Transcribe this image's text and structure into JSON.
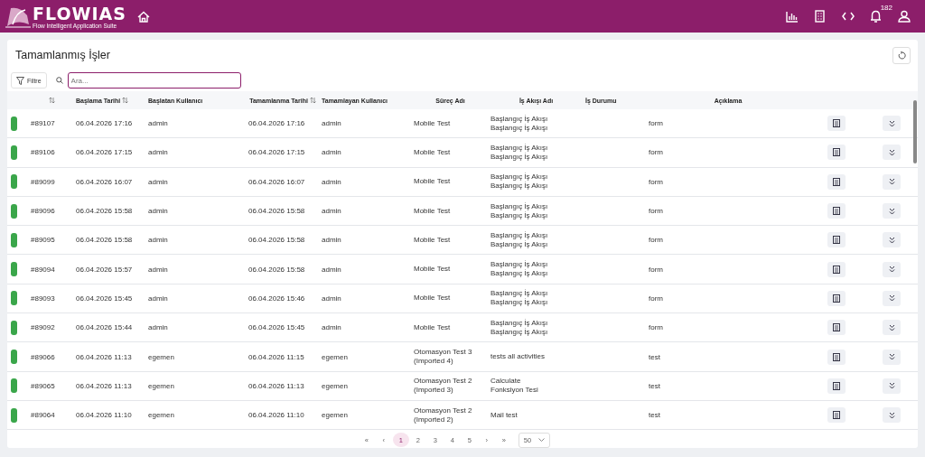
{
  "header": {
    "logo_text": "FLOWIAS",
    "logo_subtitle": "Flow Intelligent Application Suite",
    "notification_count": "182"
  },
  "page": {
    "title": "Tamamlanmış İşler",
    "filter_button": "Filtre",
    "search": {
      "placeholder": "Ara..."
    }
  },
  "table": {
    "columns": [
      "",
      "Başlama Tarihi",
      "Başlatan Kullanıcı",
      "Tamamlanma Tarihi",
      "Tamamlayan Kullanıcı",
      "Süreç Adı",
      "İş Akışı Adı",
      "İş Durumu",
      "Açıklama"
    ],
    "rows": [
      {
        "id": "#89107",
        "start": "06.04.2026 17:16",
        "starter": "admin",
        "end": "06.04.2026 17:16",
        "finisher": "admin",
        "process": [
          "Mobile Test"
        ],
        "workflow": [
          "Başlangıç İş Akışı",
          "Başlangıç İş Akışı"
        ],
        "description": "form"
      },
      {
        "id": "#89106",
        "start": "06.04.2026 17:15",
        "starter": "admin",
        "end": "06.04.2026 17:15",
        "finisher": "admin",
        "process": [
          "Mobile Test"
        ],
        "workflow": [
          "Başlangıç İş Akışı",
          "Başlangıç İş Akışı"
        ],
        "description": "form"
      },
      {
        "id": "#89099",
        "start": "06.04.2026 16:07",
        "starter": "admin",
        "end": "06.04.2026 16:07",
        "finisher": "admin",
        "process": [
          "Mobile Test"
        ],
        "workflow": [
          "Başlangıç İş Akışı",
          "Başlangıç İş Akışı"
        ],
        "description": "form"
      },
      {
        "id": "#89096",
        "start": "06.04.2026 15:58",
        "starter": "admin",
        "end": "06.04.2026 15:58",
        "finisher": "admin",
        "process": [
          "Mobile Test"
        ],
        "workflow": [
          "Başlangıç İş Akışı",
          "Başlangıç İş Akışı"
        ],
        "description": "form"
      },
      {
        "id": "#89095",
        "start": "06.04.2026 15:58",
        "starter": "admin",
        "end": "06.04.2026 15:58",
        "finisher": "admin",
        "process": [
          "Mobile Test"
        ],
        "workflow": [
          "Başlangıç İş Akışı",
          "Başlangıç İş Akışı"
        ],
        "description": "form"
      },
      {
        "id": "#89094",
        "start": "06.04.2026 15:57",
        "starter": "admin",
        "end": "06.04.2026 15:58",
        "finisher": "admin",
        "process": [
          "Mobile Test"
        ],
        "workflow": [
          "Başlangıç İş Akışı",
          "Başlangıç İş Akışı"
        ],
        "description": "form"
      },
      {
        "id": "#89093",
        "start": "06.04.2026 15:45",
        "starter": "admin",
        "end": "06.04.2026 15:46",
        "finisher": "admin",
        "process": [
          "Mobile Test"
        ],
        "workflow": [
          "Başlangıç İş Akışı",
          "Başlangıç İş Akışı"
        ],
        "description": "form"
      },
      {
        "id": "#89092",
        "start": "06.04.2026 15:44",
        "starter": "admin",
        "end": "06.04.2026 15:45",
        "finisher": "admin",
        "process": [
          "Mobile Test"
        ],
        "workflow": [
          "Başlangıç İş Akışı",
          "Başlangıç İş Akışı"
        ],
        "description": "form"
      },
      {
        "id": "#89066",
        "start": "06.04.2026 11:13",
        "starter": "egemen",
        "end": "06.04.2026 11:15",
        "finisher": "egemen",
        "process": [
          "Otomasyon Test 3",
          "(Imported 4)"
        ],
        "workflow": [
          "tests all activities"
        ],
        "description": "test"
      },
      {
        "id": "#89065",
        "start": "06.04.2026 11:13",
        "starter": "egemen",
        "end": "06.04.2026 11:13",
        "finisher": "egemen",
        "process": [
          "Otomasyon Test 2",
          "(Imported 3)"
        ],
        "workflow": [
          "Calculate",
          "Fonksiyon Tesi"
        ],
        "description": "test"
      },
      {
        "id": "#89064",
        "start": "06.04.2026 11:10",
        "starter": "egemen",
        "end": "06.04.2026 11:10",
        "finisher": "egemen",
        "process": [
          "Otomasyon Test 2",
          "(Imported 2)"
        ],
        "workflow": [
          "Mail test"
        ],
        "description": "test"
      }
    ]
  },
  "pagination": {
    "first": "«",
    "prev": "‹",
    "pages": [
      {
        "label": "1",
        "selected": true
      },
      {
        "label": "2",
        "selected": false
      },
      {
        "label": "3",
        "selected": false
      },
      {
        "label": "4",
        "selected": false
      },
      {
        "label": "5",
        "selected": false
      }
    ],
    "next": "›",
    "last": "»",
    "page_size": "50"
  }
}
